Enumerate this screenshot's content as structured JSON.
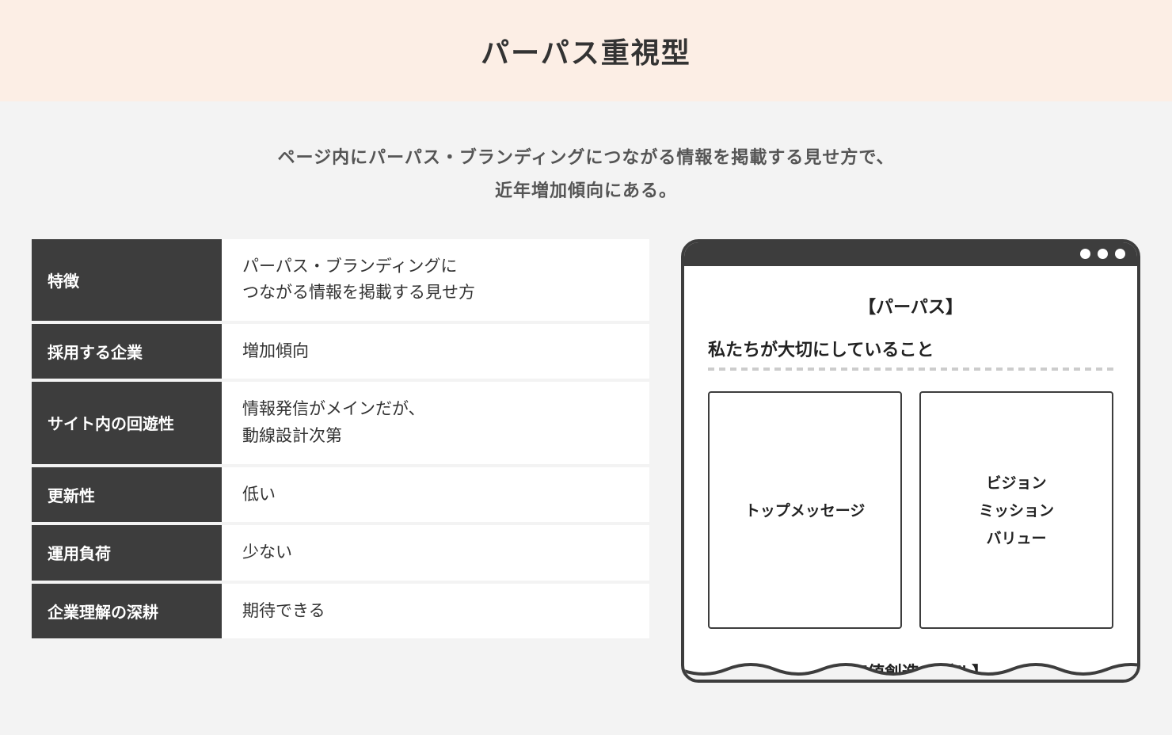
{
  "header": {
    "title": "パーパス重視型"
  },
  "description": {
    "line1": "ページ内にパーパス・ブランディングにつながる情報を掲載する見せ方で、",
    "line2": "近年増加傾向にある。"
  },
  "table": {
    "rows": [
      {
        "label": "特徴",
        "value": "パーパス・ブランディングに\nつながる情報を掲載する見せ方"
      },
      {
        "label": "採用する企業",
        "value": "増加傾向"
      },
      {
        "label": "サイト内の回遊性",
        "value": "情報発信がメインだが、\n動線設計次第"
      },
      {
        "label": "更新性",
        "value": "低い"
      },
      {
        "label": "運用負荷",
        "value": "少ない"
      },
      {
        "label": "企業理解の深耕",
        "value": "期待できる"
      }
    ]
  },
  "mock": {
    "section_title": "【パーパス】",
    "subheading": "私たちが大切にしていること",
    "card1": "トップメッセージ",
    "card2_line1": "ビジョン",
    "card2_line2": "ミッション",
    "card2_line3": "バリュー",
    "footer_title": "【価値創造モデル】"
  }
}
